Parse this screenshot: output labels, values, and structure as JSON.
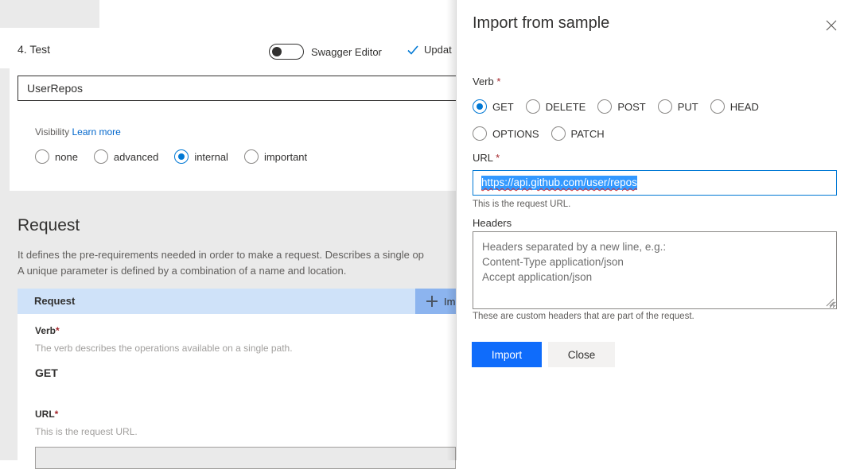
{
  "commandbar": {
    "step_title": "4. Test",
    "toggle": {
      "name": "swagger-editor-toggle",
      "label": "Swagger Editor",
      "state": "off"
    },
    "action": {
      "icon": "checkmark-icon",
      "label": "Updat"
    }
  },
  "operation": {
    "name_value": "UserRepos",
    "name_placeholder": "",
    "visibility": {
      "label": "Visibility",
      "link": "Learn more",
      "options": [
        {
          "label": "none",
          "selected": false
        },
        {
          "label": "advanced",
          "selected": false
        },
        {
          "label": "internal",
          "selected": true
        },
        {
          "label": "important",
          "selected": false
        }
      ]
    }
  },
  "request_section": {
    "title": "Request",
    "description": "It defines the pre-requirements needed in order to make a request. Describes a single op\nA unique parameter is defined by a combination of a name and location.",
    "bar_title": "Request",
    "import_label": "Impo",
    "import_icon": "plus-icon",
    "fields": {
      "verb_label": "Verb",
      "verb_required": "*",
      "verb_desc": "The verb describes the operations available on a single path.",
      "verb_value": "GET",
      "url_label": "URL",
      "url_required": "*",
      "url_desc": "This is the request URL.",
      "url_value": ""
    }
  },
  "panel": {
    "title": "Import from sample",
    "close_icon": "close-icon",
    "verb": {
      "label": "Verb",
      "required": "*",
      "options": [
        {
          "label": "GET",
          "selected": true
        },
        {
          "label": "DELETE",
          "selected": false
        },
        {
          "label": "POST",
          "selected": false
        },
        {
          "label": "PUT",
          "selected": false
        },
        {
          "label": "HEAD",
          "selected": false
        },
        {
          "label": "OPTIONS",
          "selected": false
        },
        {
          "label": "PATCH",
          "selected": false
        }
      ]
    },
    "url": {
      "label": "URL",
      "required": "*",
      "value": "https://api.github.com/user/repos",
      "selected": true,
      "help": "This is the request URL."
    },
    "headers": {
      "label": "Headers",
      "placeholder": "Headers separated by a new line, e.g.:\nContent-Type application/json\nAccept application/json",
      "value": "",
      "help": "These are custom headers that are part of the request."
    },
    "buttons": {
      "primary": "Import",
      "secondary": "Close"
    }
  },
  "colors": {
    "accent": "#0078d4",
    "primary_button": "#0f6cfb",
    "required_star": "#a4262c",
    "selection_highlight": "#3399ff",
    "spellcheck_underline": "#d13438",
    "row_highlight": "#cfe2f9",
    "row_action": "#8cb4ef",
    "page_grey": "#eaeaea"
  }
}
